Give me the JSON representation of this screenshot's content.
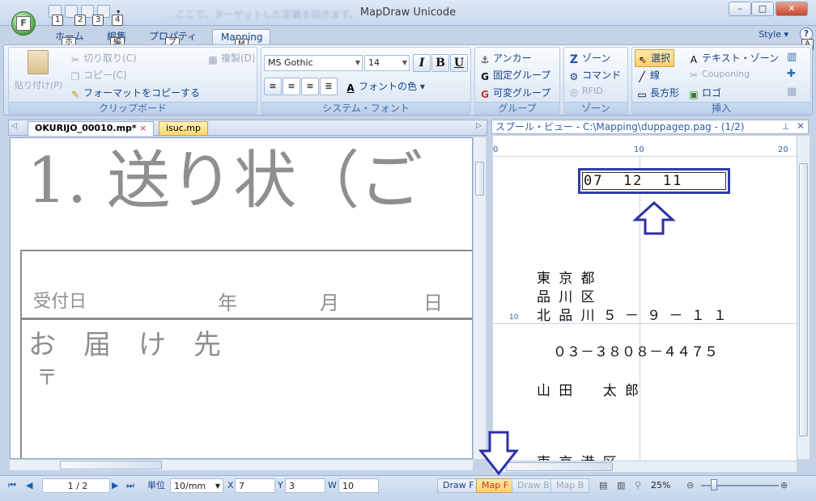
{
  "window": {
    "title": "MapDraw Unicode",
    "ghost_text": "…ここで、ターゲットした定義を除きます。",
    "min": "–",
    "max": "□",
    "close": "✕"
  },
  "app_button": {
    "key": "F"
  },
  "qat": {
    "keytips": [
      "1",
      "2",
      "3",
      "4"
    ]
  },
  "tabs": [
    {
      "label": "ホーム",
      "keytip": "ホ"
    },
    {
      "label": "編集",
      "keytip": "編"
    },
    {
      "label": "プロパティ",
      "keytip": "プ"
    },
    {
      "label": "Mapping",
      "keytip": "M"
    }
  ],
  "style_label": "Style",
  "help_label": "?",
  "help_keytip": "A",
  "ribbon": {
    "clipboard": {
      "caption": "クリップボード",
      "paste": "貼り付け(P)",
      "cut": "切り取り(C)",
      "copy": "コピー(C)",
      "duplicate": "複製(D)",
      "format_copy": "フォーマットをコピーする"
    },
    "font": {
      "caption": "システム・フォント",
      "family": "MS Gothic",
      "size": "14",
      "italic": "I",
      "bold": "B",
      "underline": "U",
      "font_color": "フォントの色"
    },
    "group": {
      "caption": "グループ",
      "anchor": "アンカー",
      "fixed": "固定グループ",
      "variable": "可変グループ"
    },
    "zone": {
      "caption": "ゾーン",
      "zone": "ゾーン",
      "command": "コマンド",
      "rfid": "RFID"
    },
    "insert": {
      "caption": "挿入",
      "select": "選択",
      "line": "線",
      "rect": "長方形",
      "text_zone": "テキスト・ゾーン",
      "couponing": "Couponing",
      "logo": "ロゴ"
    }
  },
  "doc_tabs": [
    {
      "label": "OKURIJO_00010.mp*"
    },
    {
      "label": "isuc.mp"
    }
  ],
  "doc_close": "×",
  "document": {
    "heading": "1. 送り状（ご",
    "received_label": "受付日",
    "year": "年",
    "month": "月",
    "day": "日",
    "destination": "お　届　け　先",
    "postal": "〒"
  },
  "spool": {
    "title": "スプール・ビュー - C:\\Mapping\\duppagep.pag - (1/2)",
    "ruler_ticks": [
      "0",
      "10",
      "20"
    ],
    "side_tick": "10",
    "date_field": "07  12  11",
    "lines": [
      "東 京 都",
      "品 川 区",
      "北 品 川 ５ － ９ － １ １",
      "０３－３８０８－４４７５",
      "山 田 　 太 郎",
      "東 京 港 区"
    ]
  },
  "statusbar": {
    "page": "1 / 2",
    "unit_label": "単位",
    "unit_value": "10/mm",
    "x_label": "X",
    "x_value": "7",
    "y_label": "Y",
    "y_value": "3",
    "w_label": "W",
    "w_value": "10",
    "modes": [
      "Draw F",
      "Map F",
      "Draw B",
      "Map B"
    ],
    "active_mode": "Map F",
    "zoom": "25%"
  },
  "colors": {
    "accent": "#15428b",
    "arrow": "#2d2fa8",
    "highlight": "#ffcf6a"
  }
}
